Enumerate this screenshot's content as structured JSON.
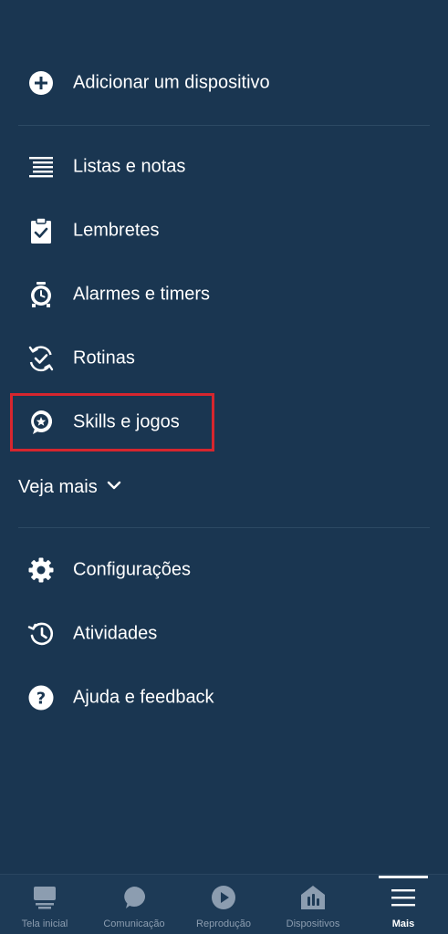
{
  "menu": {
    "add_device": {
      "label": "Adicionar um dispositivo",
      "icon": "add-circle-icon"
    },
    "items": [
      {
        "label": "Listas e notas",
        "icon": "list-icon"
      },
      {
        "label": "Lembretes",
        "icon": "clipboard-check-icon"
      },
      {
        "label": "Alarmes e timers",
        "icon": "alarm-clock-icon"
      },
      {
        "label": "Rotinas",
        "icon": "routine-check-icon"
      },
      {
        "label": "Skills e jogos",
        "icon": "skills-bubble-icon",
        "highlighted": true
      }
    ],
    "see_more": {
      "label": "Veja mais",
      "icon": "chevron-down-icon"
    },
    "settings_items": [
      {
        "label": "Configurações",
        "icon": "gear-icon"
      },
      {
        "label": "Atividades",
        "icon": "history-icon"
      },
      {
        "label": "Ajuda e feedback",
        "icon": "help-circle-icon"
      }
    ]
  },
  "bottom_nav": {
    "active": "Mais",
    "tabs": [
      {
        "label": "Tela inicial",
        "icon": "home-screen-icon"
      },
      {
        "label": "Comunicação",
        "icon": "chat-bubble-icon"
      },
      {
        "label": "Reprodução",
        "icon": "play-icon"
      },
      {
        "label": "Dispositivos",
        "icon": "devices-house-icon"
      },
      {
        "label": "Mais",
        "icon": "menu-lines-icon"
      }
    ]
  },
  "colors": {
    "background": "#1a3651",
    "nav_background": "#1d3a56",
    "text": "#ffffff",
    "nav_inactive": "#8c9db0",
    "highlight_border": "#d6262e",
    "divider": "#2c4963"
  }
}
